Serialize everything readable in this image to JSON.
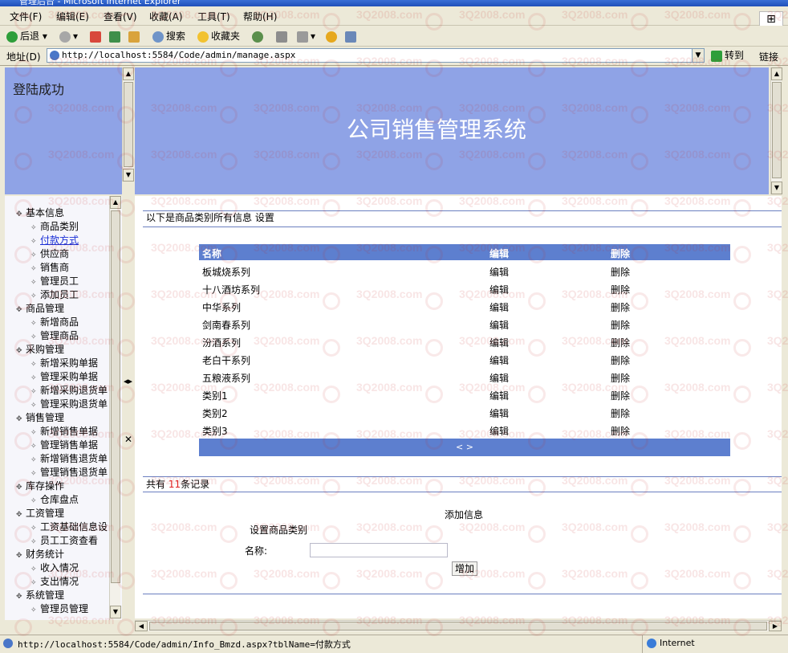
{
  "window": {
    "title": "管理后台 - Microsoft Internet Explorer"
  },
  "menu": [
    "文件(F)",
    "编辑(E)",
    "查看(V)",
    "收藏(A)",
    "工具(T)",
    "帮助(H)"
  ],
  "toolbar": {
    "back": "后退",
    "search": "搜索",
    "favorites": "收藏夹"
  },
  "address": {
    "label": "地址(D)",
    "url": "http://localhost:5584/Code/admin/manage.aspx",
    "go": "转到",
    "links": "链接"
  },
  "top_left": {
    "text": "登陆成功"
  },
  "banner": {
    "title": "公司销售管理系统"
  },
  "tree": [
    {
      "label": "基本信息",
      "level": 1
    },
    {
      "label": "商品类别",
      "level": 2
    },
    {
      "label": "付款方式",
      "level": 2,
      "link": true
    },
    {
      "label": "供应商",
      "level": 2
    },
    {
      "label": "销售商",
      "level": 2
    },
    {
      "label": "管理员工",
      "level": 2
    },
    {
      "label": "添加员工",
      "level": 2
    },
    {
      "label": "商品管理",
      "level": 1
    },
    {
      "label": "新增商品",
      "level": 2
    },
    {
      "label": "管理商品",
      "level": 2
    },
    {
      "label": "采购管理",
      "level": 1
    },
    {
      "label": "新增采购单据",
      "level": 2
    },
    {
      "label": "管理采购单据",
      "level": 2
    },
    {
      "label": "新增采购退货单",
      "level": 2
    },
    {
      "label": "管理采购退货单",
      "level": 2
    },
    {
      "label": "销售管理",
      "level": 1
    },
    {
      "label": "新增销售单据",
      "level": 2
    },
    {
      "label": "管理销售单据",
      "level": 2
    },
    {
      "label": "新增销售退货单",
      "level": 2
    },
    {
      "label": "管理销售退货单",
      "level": 2
    },
    {
      "label": "库存操作",
      "level": 1
    },
    {
      "label": "仓库盘点",
      "level": 2
    },
    {
      "label": "工资管理",
      "level": 1
    },
    {
      "label": "工资基础信息设",
      "level": 2
    },
    {
      "label": "员工工资查看",
      "level": 2
    },
    {
      "label": "财务统计",
      "level": 1
    },
    {
      "label": "收入情况",
      "level": 2
    },
    {
      "label": "支出情况",
      "level": 2
    },
    {
      "label": "系统管理",
      "level": 1
    },
    {
      "label": "管理员管理",
      "level": 2
    }
  ],
  "main": {
    "header": "以下是商品类别所有信息 设置",
    "columns": [
      "名称",
      "编辑",
      "删除"
    ],
    "rows": [
      {
        "name": "板城烧系列",
        "edit": "编辑",
        "del": "删除"
      },
      {
        "name": "十八酒坊系列",
        "edit": "编辑",
        "del": "删除"
      },
      {
        "name": "中华系列",
        "edit": "编辑",
        "del": "删除"
      },
      {
        "name": "剑南春系列",
        "edit": "编辑",
        "del": "删除"
      },
      {
        "name": "汾酒系列",
        "edit": "编辑",
        "del": "删除"
      },
      {
        "name": "老白干系列",
        "edit": "编辑",
        "del": "删除"
      },
      {
        "name": "五粮液系列",
        "edit": "编辑",
        "del": "删除"
      },
      {
        "name": "类别1",
        "edit": "编辑",
        "del": "删除"
      },
      {
        "name": "类别2",
        "edit": "编辑",
        "del": "删除"
      },
      {
        "name": "类别3",
        "edit": "编辑",
        "del": "删除"
      }
    ],
    "pager": "< >",
    "count_prefix": "共有",
    "count": "11",
    "count_suffix": "条记录",
    "add_title": "添加信息",
    "add_subtitle": "设置商品类别",
    "name_label": "名称:",
    "name_value": "",
    "add_button": "增加"
  },
  "divider": {
    "toggle": "◂▸",
    "close": "✕"
  },
  "status": {
    "url": "http://localhost:5584/Code/admin/Info_Bmzd.aspx?tblName=付款方式",
    "zone": "Internet"
  },
  "watermark": "3Q2008.com"
}
